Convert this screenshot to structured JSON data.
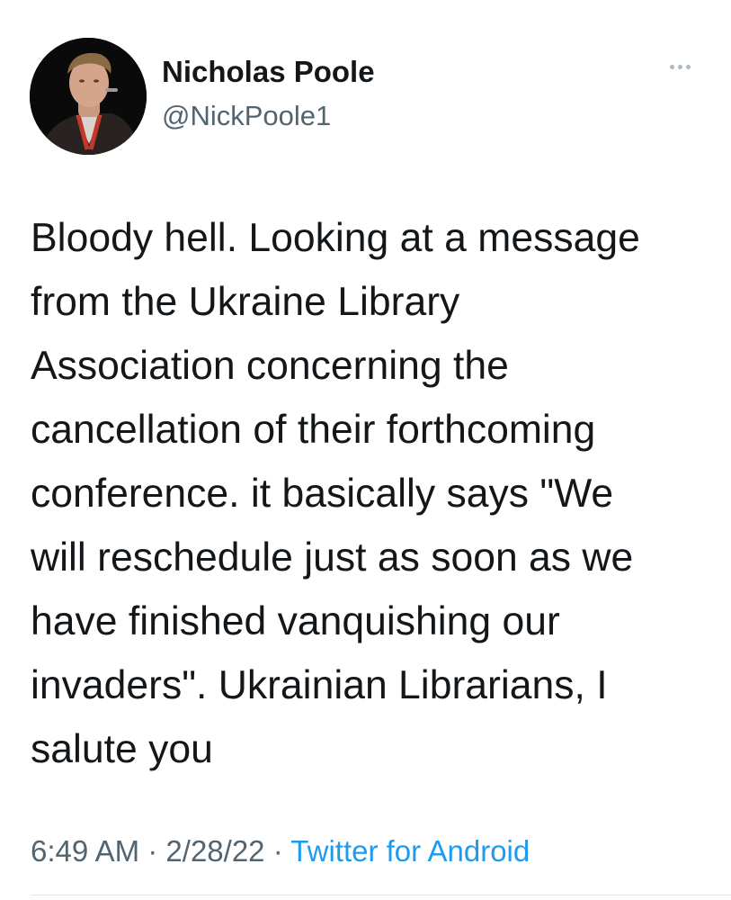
{
  "author": {
    "name": "Nicholas Poole",
    "handle": "@NickPoole1"
  },
  "more_icon": "more-horizontal-icon",
  "tweet": {
    "lines": [
      "Bloody hell. Looking at a message",
      "from the Ukraine Library",
      "Association concerning the",
      "cancellation of their forthcoming",
      "conference. it basically says \"We",
      "will reschedule just as soon as we",
      "have finished vanquishing our",
      "invaders\". Ukrainian Librarians, I",
      "salute you"
    ]
  },
  "meta": {
    "time": "6:49 AM",
    "date": "2/28/22",
    "separator": "·",
    "source": "Twitter for Android"
  },
  "colors": {
    "text": "#14171a",
    "secondary": "#536471",
    "link": "#1d9bf0"
  }
}
